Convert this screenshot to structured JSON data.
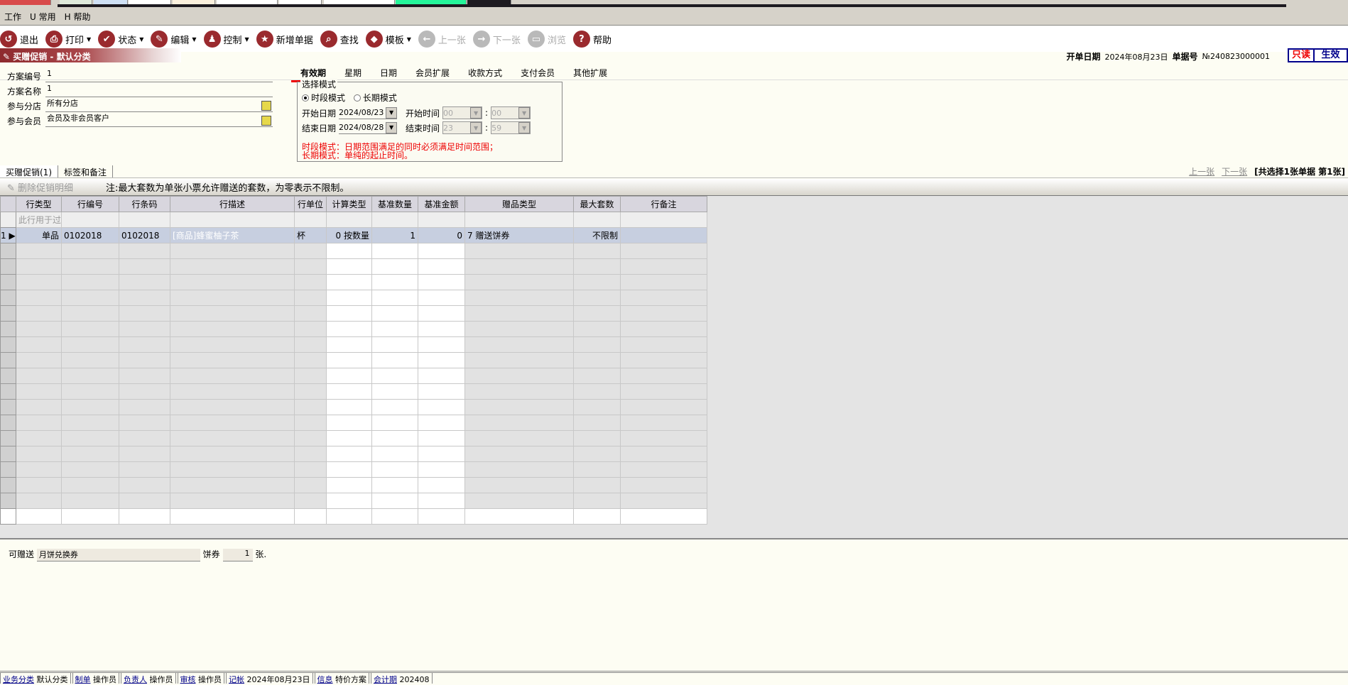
{
  "colors": {
    "accent": "#9a2a2e",
    "selection": "#0c2461",
    "note": "#e00000",
    "stamp_blue": "#00008b"
  },
  "menu": [
    "工作",
    "U 常用",
    "H 帮助"
  ],
  "toolbar": [
    {
      "label": "退出",
      "icon": "exit-icon",
      "glyph": "↺",
      "dropdown": false,
      "disabled": false
    },
    {
      "label": "打印",
      "icon": "print-icon",
      "glyph": "⎙",
      "dropdown": true,
      "disabled": false
    },
    {
      "label": "状态",
      "icon": "check-icon",
      "glyph": "✔",
      "dropdown": true,
      "disabled": false
    },
    {
      "label": "编辑",
      "icon": "pencil-icon",
      "glyph": "✎",
      "dropdown": true,
      "disabled": false
    },
    {
      "label": "控制",
      "icon": "user-icon",
      "glyph": "♟",
      "dropdown": true,
      "disabled": false
    },
    {
      "label": "新增单据",
      "icon": "star-icon",
      "glyph": "★",
      "dropdown": false,
      "disabled": false
    },
    {
      "label": "查找",
      "icon": "search-icon",
      "glyph": "⌕",
      "dropdown": false,
      "disabled": false
    },
    {
      "label": "模板",
      "icon": "eraser-icon",
      "glyph": "◆",
      "dropdown": true,
      "disabled": false
    },
    {
      "label": "上一张",
      "icon": "arrow-left-icon",
      "glyph": "←",
      "dropdown": false,
      "disabled": true
    },
    {
      "label": "下一张",
      "icon": "arrow-right-icon",
      "glyph": "→",
      "dropdown": false,
      "disabled": true
    },
    {
      "label": "浏览",
      "icon": "folder-icon",
      "glyph": "▭",
      "dropdown": false,
      "disabled": true
    },
    {
      "label": "帮助",
      "icon": "help-icon",
      "glyph": "?",
      "dropdown": false,
      "disabled": false
    }
  ],
  "title": "买赠促销 - 默认分类",
  "doc": {
    "date_label": "开单日期",
    "date": "2024年08月23日",
    "no_label": "单据号",
    "no": "№240823000001",
    "readonly": "只读",
    "effective": "生效"
  },
  "form": {
    "code_label": "方案编号",
    "code": "1",
    "name_label": "方案名称",
    "name": "1",
    "branch_label": "参与分店",
    "branch": "所有分店",
    "member_label": "参与会员",
    "member": "会员及非会员客户"
  },
  "tabs": [
    "有效期",
    "星期",
    "日期",
    "会员扩展",
    "收款方式",
    "支付会员",
    "其他扩展"
  ],
  "period": {
    "legend": "选择模式",
    "mode1": "时段模式",
    "mode2": "长期模式",
    "start_date_label": "开始日期",
    "start_date": "2024/08/23",
    "end_date_label": "结束日期",
    "end_date": "2024/08/28",
    "start_time_label": "开始时间",
    "start_h": "00",
    "start_m": "00",
    "end_time_label": "结束时间",
    "end_h": "23",
    "end_m": "59",
    "note1": "时段模式：日期范围满足的同时必须满足时间范围；",
    "note2": "长期模式：单纯的起止时间。"
  },
  "subtabs": [
    "买赠促销(1)",
    "标签和备注"
  ],
  "nav": {
    "prev": "上一张",
    "next": "下一张",
    "info": "[共选择1张单据  第1张]"
  },
  "grid_tool": {
    "delete": "删除促销明细",
    "note": "注:最大套数为单张小票允许赠送的套数，为零表示不限制。"
  },
  "grid": {
    "headers": [
      "行类型",
      "行编号",
      "行条码",
      "行描述",
      "行单位",
      "计算类型",
      "基准数量",
      "基准金额",
      "赠品类型",
      "最大套数",
      "行备注"
    ],
    "filter_hint": "此行用于过",
    "rows": [
      {
        "index": "1",
        "cells": [
          "单品",
          "0102018",
          "0102018",
          "[商品]蜂蜜柚子茶",
          "杯",
          "0 按数量",
          "1",
          "0",
          "7 赠送饼券",
          "不限制",
          ""
        ]
      }
    ]
  },
  "bottom": {
    "label": "可赠送",
    "coupon": "月饼兑换券",
    "unit_label": "饼券",
    "qty": "1",
    "suffix": "张."
  },
  "status": [
    {
      "k": "业务分类",
      "v": "默认分类"
    },
    {
      "k": "制单",
      "v": "操作员"
    },
    {
      "k": "负责人",
      "v": "操作员"
    },
    {
      "k": "审核",
      "v": "操作员"
    },
    {
      "k": "记帐",
      "v": "2024年08月23日"
    },
    {
      "k": "信息",
      "v": "特价方案"
    },
    {
      "k": "会计期",
      "v": "202408"
    }
  ]
}
